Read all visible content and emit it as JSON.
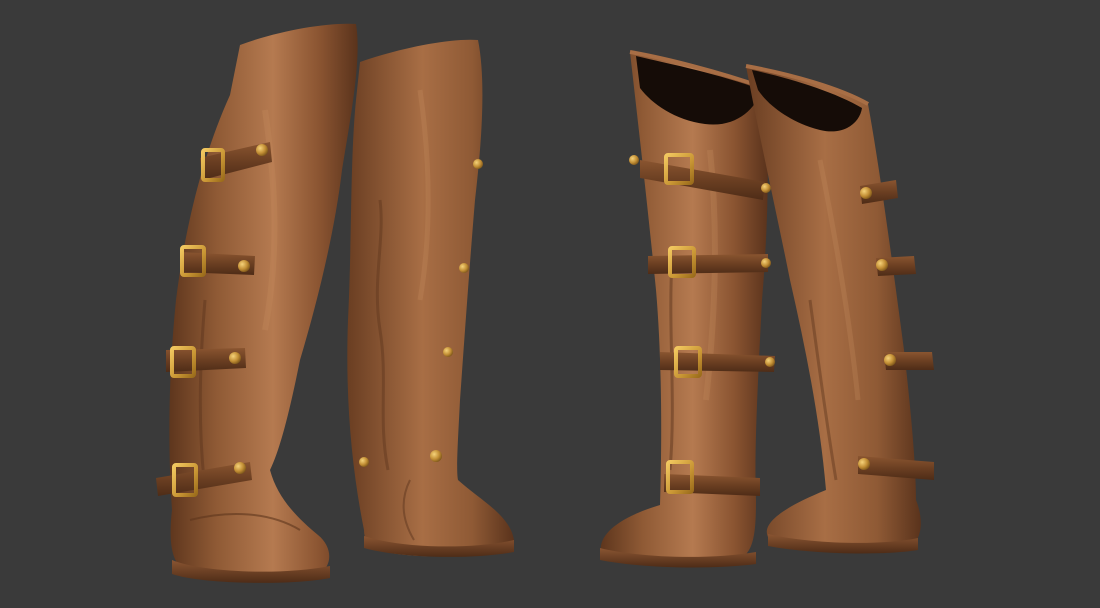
{
  "scene": {
    "subject": "boot-render",
    "colors": {
      "background": "#3a3a3a",
      "leather_light": "#b57a50",
      "leather_mid": "#8f5a35",
      "leather_dark": "#5a331c",
      "interior": "#150c07",
      "brass_light": "#f2c860",
      "brass_dark": "#9c6d1c"
    }
  }
}
